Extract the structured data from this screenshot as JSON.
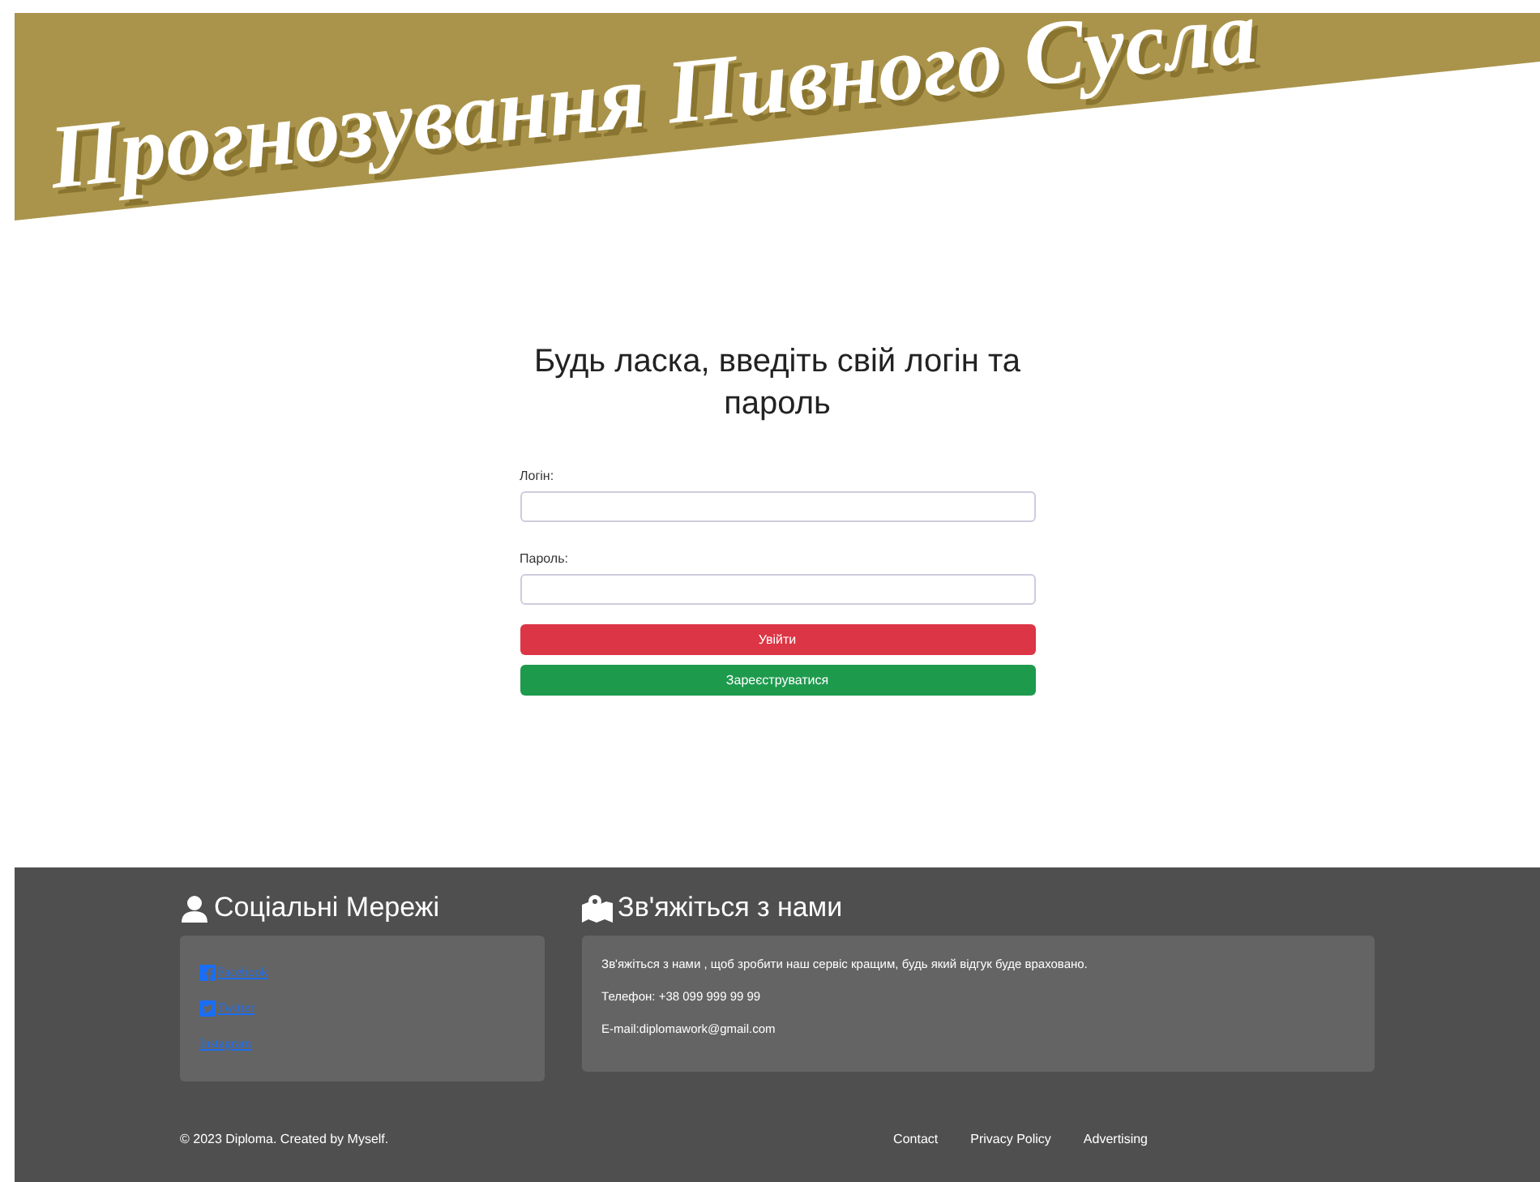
{
  "header": {
    "title": "Прогнозування Пивного Сусла"
  },
  "login": {
    "heading": "Будь ласка, введіть свій логін та пароль",
    "fields": [
      {
        "label": "Логін:"
      },
      {
        "label": "Пароль:"
      }
    ],
    "buttons": [
      {
        "label": "Увійти",
        "kind": "danger"
      },
      {
        "label": "Зареєструватися",
        "kind": "success"
      }
    ]
  },
  "footer": {
    "social": {
      "heading": "Соціальні Мережі",
      "links": [
        {
          "label": "Facebook",
          "kind": "facebook"
        },
        {
          "label": "Twitter",
          "kind": "twitter"
        },
        {
          "label": "Instagram",
          "kind": "plain"
        }
      ]
    },
    "contact": {
      "heading": "Зв'яжіться з нами",
      "lines": [
        "Зв'яжіться з нами , щоб зробити наш сервіс кращим, будь який відгук буде враховано.",
        "Телефон: +38 099 999 99 99",
        "E-mail:diplomawork@gmail.com"
      ]
    },
    "copyright": "© 2023 Diploma. Created by Myself.",
    "links": [
      "Contact",
      "Privacy Policy",
      "Advertising"
    ]
  }
}
